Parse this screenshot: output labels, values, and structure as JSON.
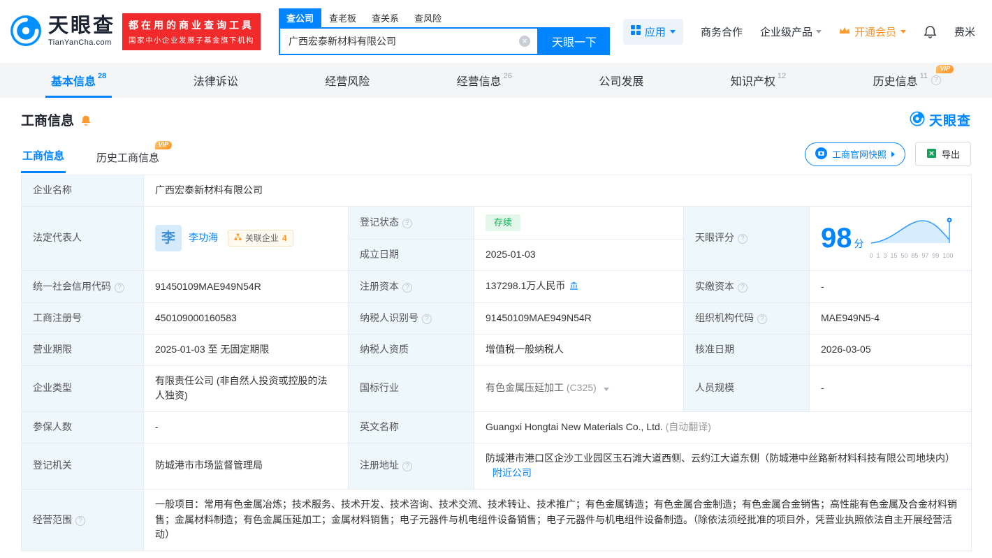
{
  "brand": {
    "name": "天眼查",
    "domain": "TianYanCha.com",
    "promo_line1": "都在用的商业查询工具",
    "promo_line2": "国家中小企业发展子基金旗下机构"
  },
  "badges": {
    "vip": "VIP"
  },
  "search": {
    "tabs": [
      {
        "label": "查公司"
      },
      {
        "label": "查老板"
      },
      {
        "label": "查关系"
      },
      {
        "label": "查风险"
      }
    ],
    "value": "广西宏泰新材料有限公司",
    "button": "天眼一下"
  },
  "top_menu": {
    "apps": "应用",
    "cooperation": "商务合作",
    "enterprise": "企业级产品",
    "vip": "开通会员",
    "user": "费米"
  },
  "nav_tabs": [
    {
      "label": "基本信息",
      "count": "28"
    },
    {
      "label": "法律诉讼",
      "count": ""
    },
    {
      "label": "经营风险",
      "count": ""
    },
    {
      "label": "经营信息",
      "count": "26"
    },
    {
      "label": "公司发展",
      "count": ""
    },
    {
      "label": "知识产权",
      "count": "12"
    },
    {
      "label": "历史信息",
      "count": "11"
    }
  ],
  "section": {
    "title": "工商信息",
    "watermark": "天眼查",
    "tab_current": "工商信息",
    "tab_history": "历史工商信息",
    "snapshot_button": "工商官网快照",
    "export_button": "导出"
  },
  "fields": {
    "company_name_label": "企业名称",
    "company_name": "广西宏泰新材料有限公司",
    "legal_rep_label": "法定代表人",
    "legal_rep_initial": "李",
    "legal_rep_name": "李功海",
    "related_label": "关联企业",
    "related_count": "4",
    "reg_status_label": "登记状态",
    "reg_status": "存续",
    "establish_label": "成立日期",
    "establish_date": "2025-01-03",
    "score_label": "天眼评分",
    "score_value": "98",
    "score_unit": "分",
    "score_axis": [
      "0",
      "1",
      "3",
      "15",
      "50",
      "85",
      "97",
      "99",
      "100"
    ],
    "credit_code_label": "统一社会信用代码",
    "credit_code": "91450109MAE949N54R",
    "reg_capital_label": "注册资本",
    "reg_capital": "137298.1万人民币",
    "paid_capital_label": "实缴资本",
    "paid_capital": "-",
    "reg_number_label": "工商注册号",
    "reg_number": "450109000160583",
    "taxpayer_id_label": "纳税人识别号",
    "taxpayer_id": "91450109MAE949N54R",
    "org_code_label": "组织机构代码",
    "org_code": "MAE949N5-4",
    "business_term_label": "营业期限",
    "business_term": "2025-01-03 至 无固定期限",
    "taxpayer_quality_label": "纳税人资质",
    "taxpayer_quality": "增值税一般纳税人",
    "approval_date_label": "核准日期",
    "approval_date": "2026-03-05",
    "company_type_label": "企业类型",
    "company_type": "有限责任公司 (非自然人投资或控股的法人独资)",
    "industry_label": "国标行业",
    "industry": "有色金属压延加工",
    "industry_code": "(C325)",
    "staff_label": "人员规模",
    "staff": "-",
    "insured_label": "参保人数",
    "insured": "-",
    "english_label": "英文名称",
    "english_name": "Guangxi Hongtai New Materials Co., Ltd.",
    "english_note": "(自动翻译)",
    "authority_label": "登记机关",
    "authority": "防城港市市场监督管理局",
    "address_label": "注册地址",
    "address": "防城港市港口区企沙工业园区玉石滩大道西侧、云约江大道东侧（防城港中丝路新材料科技有限公司地块内）",
    "nearby_link": "附近公司",
    "scope_label": "经营范围",
    "scope": "一般项目：常用有色金属冶炼；技术服务、技术开发、技术咨询、技术交流、技术转让、技术推广；有色金属铸造；有色金属合金制造；有色金属合金销售；高性能有色金属及合金材料销售；金属材料制造；有色金属压延加工；金属材料销售；电子元器件与机电组件设备销售；电子元器件与机电组件设备制造。（除依法须经批准的项目外，凭营业执照依法自主开展经营活动）"
  }
}
